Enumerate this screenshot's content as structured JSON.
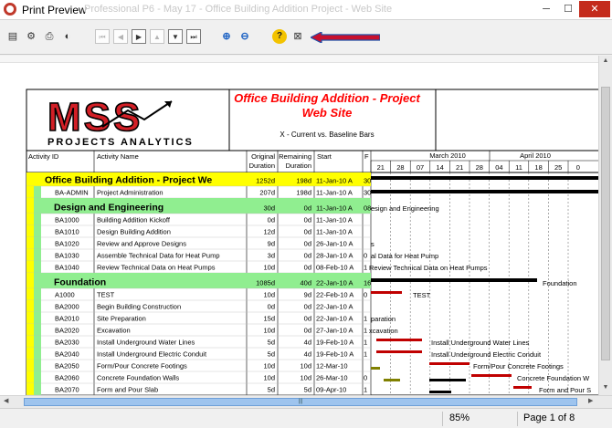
{
  "window": {
    "title": "Print Preview",
    "ghost_title": "Professional P6 - May 17 - Office Building Addition Project - Web Site"
  },
  "toolbar": {
    "buttons": [
      {
        "name": "page-setup-icon",
        "glyph": "▤"
      },
      {
        "name": "print-setup-icon",
        "glyph": "⚙"
      },
      {
        "name": "print-icon",
        "glyph": "⎙"
      },
      {
        "name": "publish-icon",
        "glyph": "◐"
      },
      {
        "name": "first-page-icon",
        "glyph": "⏮"
      },
      {
        "name": "previous-page-icon",
        "glyph": "◀"
      },
      {
        "name": "next-page-icon",
        "glyph": "▶"
      },
      {
        "name": "page-up-icon",
        "glyph": "▲"
      },
      {
        "name": "page-down-icon",
        "glyph": "▼"
      },
      {
        "name": "last-page-icon",
        "glyph": "⏭"
      },
      {
        "name": "zoom-in-icon",
        "glyph": "⊕"
      },
      {
        "name": "zoom-out-icon",
        "glyph": "⊖"
      },
      {
        "name": "help-icon",
        "glyph": "?"
      },
      {
        "name": "close-preview-icon",
        "glyph": "⊠"
      }
    ]
  },
  "report": {
    "logo_text": "MSS",
    "logo_subtitle": "PROJECTS ANALYTICS",
    "title_line1": "Office Building Addition - Project",
    "title_line2": "Web Site",
    "subtitle": "X - Current vs. Baseline Bars",
    "columns": {
      "activity_id": "Activity ID",
      "activity_name": "Activity Name",
      "orig_duration": "Original Duration",
      "rem_duration": "Remaining Duration",
      "start": "Start",
      "finish": "F"
    },
    "timescale": {
      "months": [
        "March 2010",
        "April 2010"
      ],
      "days": [
        "21",
        "28",
        "07",
        "14",
        "21",
        "28",
        "04",
        "11",
        "18",
        "25",
        "0"
      ]
    },
    "rows": [
      {
        "type": "project",
        "id": "Office Building Addition - Project We",
        "name": "",
        "od": "1252d",
        "rd": "198d",
        "start": "11-Jan-10 A",
        "fin": "30",
        "gantt": ""
      },
      {
        "type": "activity",
        "id": "BA-ADMIN",
        "name": "Project Administration",
        "od": "207d",
        "rd": "198d",
        "start": "11-Jan-10 A",
        "fin": "30",
        "gantt": ""
      },
      {
        "type": "wbs",
        "id": "Design and Engineering",
        "name": "",
        "od": "30d",
        "rd": "0d",
        "start": "11-Jan-10 A",
        "fin": "08",
        "gantt": "esign and Engineering"
      },
      {
        "type": "activity",
        "id": "BA1000",
        "name": "Building Addition Kickoff",
        "od": "0d",
        "rd": "0d",
        "start": "11-Jan-10 A",
        "fin": "",
        "gantt": ""
      },
      {
        "type": "activity",
        "id": "BA1010",
        "name": "Design Building Addition",
        "od": "12d",
        "rd": "0d",
        "start": "11-Jan-10 A",
        "fin": "",
        "gantt": ""
      },
      {
        "type": "activity",
        "id": "BA1020",
        "name": "Review and Approve Designs",
        "od": "9d",
        "rd": "0d",
        "start": "26-Jan-10 A",
        "fin": "",
        "gantt": "s"
      },
      {
        "type": "activity",
        "id": "BA1030",
        "name": "Assemble Technical Data for Heat Pump",
        "od": "3d",
        "rd": "0d",
        "start": "28-Jan-10 A",
        "fin": "0",
        "gantt": "al Data for Heat Pump"
      },
      {
        "type": "activity",
        "id": "BA1040",
        "name": "Review Technical Data on Heat Pumps",
        "od": "10d",
        "rd": "0d",
        "start": "08-Feb-10 A",
        "fin": "1",
        "gantt": "Review Technical Data on Heat Pumps"
      },
      {
        "type": "wbs",
        "id": "Foundation",
        "name": "",
        "od": "1085d",
        "rd": "40d",
        "start": "22-Jan-10 A",
        "fin": "16",
        "gantt": "Foundation"
      },
      {
        "type": "activity",
        "id": "A1000",
        "name": "TEST",
        "od": "10d",
        "rd": "9d",
        "start": "22-Feb-10 A",
        "fin": "0",
        "gantt": "TEST"
      },
      {
        "type": "activity",
        "id": "BA2000",
        "name": "Begin Building Construction",
        "od": "0d",
        "rd": "0d",
        "start": "22-Jan-10 A",
        "fin": "",
        "gantt": ""
      },
      {
        "type": "activity",
        "id": "BA2010",
        "name": "Site Preparation",
        "od": "15d",
        "rd": "0d",
        "start": "22-Jan-10 A",
        "fin": "1",
        "gantt": "paration"
      },
      {
        "type": "activity",
        "id": "BA2020",
        "name": "Excavation",
        "od": "10d",
        "rd": "0d",
        "start": "27-Jan-10 A",
        "fin": "1",
        "gantt": "xcavation"
      },
      {
        "type": "activity",
        "id": "BA2030",
        "name": "Install Underground Water Lines",
        "od": "5d",
        "rd": "4d",
        "start": "19-Feb-10 A",
        "fin": "1",
        "gantt": "Install Underground Water Lines"
      },
      {
        "type": "activity",
        "id": "BA2040",
        "name": "Install Underground Electric Conduit",
        "od": "5d",
        "rd": "4d",
        "start": "19-Feb-10 A",
        "fin": "1",
        "gantt": "Install Underground Electric Conduit"
      },
      {
        "type": "activity",
        "id": "BA2050",
        "name": "Form/Pour Concrete Footings",
        "od": "10d",
        "rd": "10d",
        "start": "12-Mar-10",
        "fin": "",
        "gantt": "Form/Pour Concrete Footings"
      },
      {
        "type": "activity",
        "id": "BA2060",
        "name": "Concrete Foundation Walls",
        "od": "10d",
        "rd": "10d",
        "start": "26-Mar-10",
        "fin": "0",
        "gantt": "Concrete Foundation W"
      },
      {
        "type": "activity",
        "id": "BA2070",
        "name": "Form and Pour Slab",
        "od": "5d",
        "rd": "5d",
        "start": "09-Apr-10",
        "fin": "1",
        "gantt": "Form and Pour S"
      }
    ]
  },
  "status": {
    "zoom": "85%",
    "page": "Page 1 of 8"
  },
  "colors": {
    "project_band": "#ffff00",
    "wbs_band": "#90ee90",
    "title_red": "#ff0000",
    "bar_red": "#c00000",
    "bar_black": "#000000",
    "bar_olive": "#808000",
    "arrow_red": "#c8102e",
    "arrow_blue": "#1f4fa8"
  }
}
